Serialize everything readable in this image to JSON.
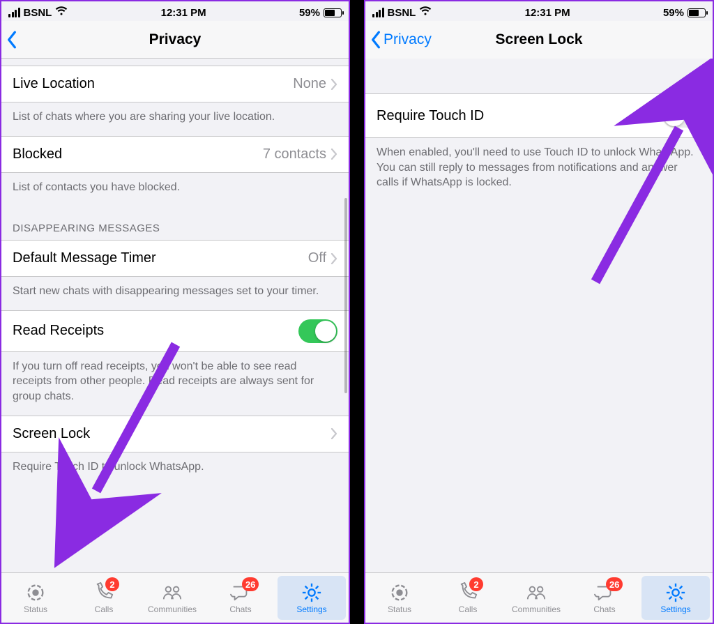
{
  "status": {
    "carrier": "BSNL",
    "time": "12:31 PM",
    "battery_pct": "59%"
  },
  "left": {
    "nav_title": "Privacy",
    "rows": {
      "live_location": {
        "label": "Live Location",
        "value": "None"
      },
      "live_location_footer": "List of chats where you are sharing your live location.",
      "blocked": {
        "label": "Blocked",
        "value": "7 contacts"
      },
      "blocked_footer": "List of contacts you have blocked.",
      "disappearing_header": "DISAPPEARING MESSAGES",
      "default_timer": {
        "label": "Default Message Timer",
        "value": "Off"
      },
      "default_timer_footer": "Start new chats with disappearing messages set to your timer.",
      "read_receipts": {
        "label": "Read Receipts"
      },
      "read_receipts_footer": "If you turn off read receipts, you won't be able to see read receipts from other people. Read receipts are always sent for group chats.",
      "screen_lock": {
        "label": "Screen Lock"
      },
      "screen_lock_footer": "Require Touch ID to unlock WhatsApp."
    }
  },
  "right": {
    "back_label": "Privacy",
    "nav_title": "Screen Lock",
    "require_touch_id": {
      "label": "Require Touch ID"
    },
    "require_touch_id_footer": "When enabled, you'll need to use Touch ID to unlock WhatsApp. You can still reply to messages from notifications and answer calls if WhatsApp is locked."
  },
  "tabs": {
    "status": "Status",
    "calls": "Calls",
    "communities": "Communities",
    "chats": "Chats",
    "settings": "Settings",
    "calls_badge": "2",
    "chats_badge": "26"
  },
  "colors": {
    "accent": "#007aff",
    "arrow": "#8a2be2",
    "toggle_on": "#34c759"
  }
}
